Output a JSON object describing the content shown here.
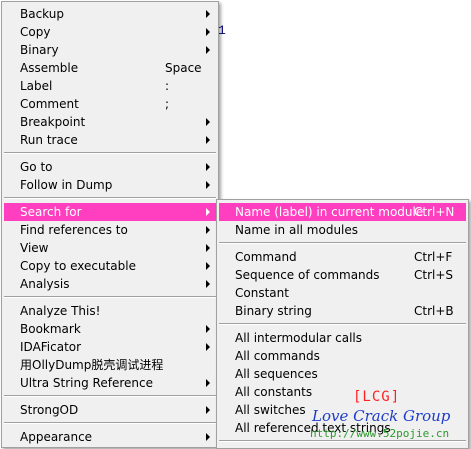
{
  "background": {
    "fragment": "1"
  },
  "main_menu": {
    "items": [
      {
        "label": "Backup",
        "shortcut": "",
        "submenu": true
      },
      {
        "label": "Copy",
        "shortcut": "",
        "submenu": true
      },
      {
        "label": "Binary",
        "shortcut": "",
        "submenu": true
      },
      {
        "label": "Assemble",
        "shortcut": "Space",
        "submenu": false
      },
      {
        "label": "Label",
        "shortcut": ":",
        "submenu": false
      },
      {
        "label": "Comment",
        "shortcut": ";",
        "submenu": false
      },
      {
        "label": "Breakpoint",
        "shortcut": "",
        "submenu": true
      },
      {
        "label": "Run trace",
        "shortcut": "",
        "submenu": true
      },
      {
        "label": "Go to",
        "shortcut": "",
        "submenu": true
      },
      {
        "label": "Follow in Dump",
        "shortcut": "",
        "submenu": true
      },
      {
        "label": "Search for",
        "shortcut": "",
        "submenu": true
      },
      {
        "label": "Find references to",
        "shortcut": "",
        "submenu": true
      },
      {
        "label": "View",
        "shortcut": "",
        "submenu": true
      },
      {
        "label": "Copy to executable",
        "shortcut": "",
        "submenu": true
      },
      {
        "label": "Analysis",
        "shortcut": "",
        "submenu": true
      },
      {
        "label": "Analyze This!",
        "shortcut": "",
        "submenu": false
      },
      {
        "label": "Bookmark",
        "shortcut": "",
        "submenu": true
      },
      {
        "label": "IDAFicator",
        "shortcut": "",
        "submenu": true
      },
      {
        "label": "用OllyDump脱壳调试进程",
        "shortcut": "",
        "submenu": false
      },
      {
        "label": "Ultra String Reference",
        "shortcut": "",
        "submenu": true
      },
      {
        "label": "StrongOD",
        "shortcut": "",
        "submenu": true
      },
      {
        "label": "Appearance",
        "shortcut": "",
        "submenu": true
      }
    ]
  },
  "search_submenu": {
    "items": [
      {
        "label": "Name (label) in current module",
        "shortcut": "Ctrl+N"
      },
      {
        "label": "Name in all modules",
        "shortcut": ""
      },
      {
        "label": "Command",
        "shortcut": "Ctrl+F"
      },
      {
        "label": "Sequence of commands",
        "shortcut": "Ctrl+S"
      },
      {
        "label": "Constant",
        "shortcut": ""
      },
      {
        "label": "Binary string",
        "shortcut": "Ctrl+B"
      },
      {
        "label": "All intermodular calls",
        "shortcut": ""
      },
      {
        "label": "All commands",
        "shortcut": ""
      },
      {
        "label": "All sequences",
        "shortcut": ""
      },
      {
        "label": "All constants",
        "shortcut": ""
      },
      {
        "label": "All switches",
        "shortcut": ""
      },
      {
        "label": "All referenced text strings",
        "shortcut": ""
      }
    ]
  },
  "watermark": {
    "tag": "[LCG]",
    "title": "Love Crack Group",
    "url": "http://www.52pojie.cn"
  },
  "colors": {
    "highlight": "#ff3fbf",
    "menu_bg": "#f0f0f0"
  }
}
